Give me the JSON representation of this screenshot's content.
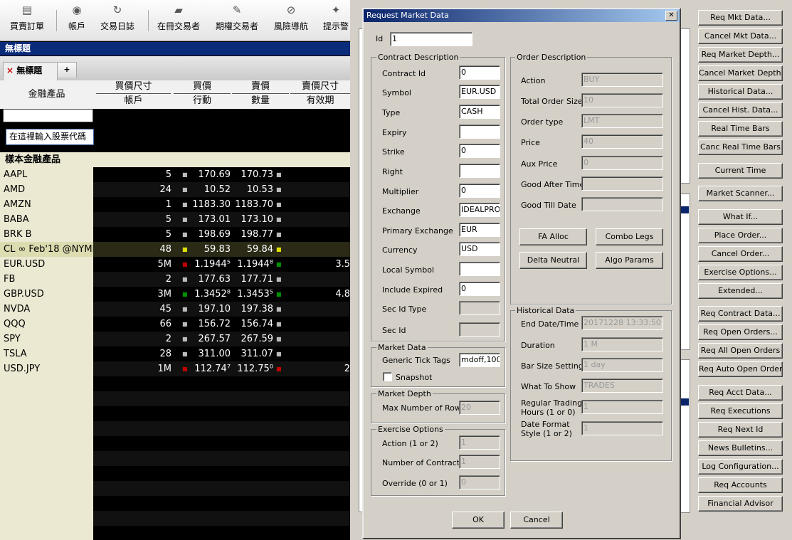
{
  "toolbar": {
    "buttons": [
      {
        "label": "買賣訂單",
        "icon": "order-icon"
      },
      {
        "label": "帳戶",
        "icon": "account-coins-icon"
      },
      {
        "label": "交易日誌",
        "icon": "trade-log-icon"
      },
      {
        "label": "在冊交易者",
        "icon": "book-trader-icon"
      },
      {
        "label": "期權交易者",
        "icon": "option-trader-icon"
      },
      {
        "label": "風險導航",
        "icon": "compass-icon"
      },
      {
        "label": "提示警",
        "icon": "alert-icon"
      }
    ]
  },
  "window": {
    "title": "無標題"
  },
  "tabs": [
    {
      "label": "無標題",
      "close": "×"
    },
    {
      "label": "+"
    }
  ],
  "columns": {
    "row1": [
      "買價尺寸",
      "買價",
      "賣價",
      "賣價尺寸"
    ],
    "row2": [
      "帳戶",
      "行動",
      "數量",
      "有效期"
    ],
    "instrument": "金融產品"
  },
  "symbol_input": {
    "value": "",
    "tooltip": "在這裡輸入股票代碼"
  },
  "section_header": "樣本金融產品",
  "quotes": [
    {
      "symbol": "AAPL",
      "bid_size": "5",
      "bid": "170.69",
      "ask": "170.73",
      "ask_size": "",
      "tick": "w"
    },
    {
      "symbol": "AMD",
      "bid_size": "24",
      "bid": "10.52",
      "ask": "10.53",
      "ask_size": "",
      "tick": "w"
    },
    {
      "symbol": "AMZN",
      "bid_size": "1",
      "bid": "1183.30",
      "ask": "1183.70",
      "ask_size": "",
      "tick": "w"
    },
    {
      "symbol": "BABA",
      "bid_size": "5",
      "bid": "173.01",
      "ask": "173.10",
      "ask_size": "",
      "tick": "w"
    },
    {
      "symbol": "BRK B",
      "bid_size": "5",
      "bid": "198.69",
      "ask": "198.77",
      "ask_size": "",
      "tick": "w"
    },
    {
      "symbol": "CL ∞ Feb'18 @NYMEX",
      "bid_size": "48",
      "bid": "59.83",
      "ask": "59.84",
      "ask_size": "",
      "tick": "y"
    },
    {
      "symbol": "EUR.USD",
      "bid_size": "5M",
      "bid": "1.1944⁵",
      "ask": "1.1944⁸",
      "ask_size": "3.5",
      "tick": "rg"
    },
    {
      "symbol": "FB",
      "bid_size": "2",
      "bid": "177.63",
      "ask": "177.71",
      "ask_size": "",
      "tick": "w"
    },
    {
      "symbol": "GBP.USD",
      "bid_size": "3M",
      "bid": "1.3452⁸",
      "ask": "1.3453⁵",
      "ask_size": "4.8",
      "tick": "gg"
    },
    {
      "symbol": "NVDA",
      "bid_size": "45",
      "bid": "197.10",
      "ask": "197.38",
      "ask_size": "",
      "tick": "w"
    },
    {
      "symbol": "QQQ",
      "bid_size": "66",
      "bid": "156.72",
      "ask": "156.74",
      "ask_size": "",
      "tick": "w"
    },
    {
      "symbol": "SPY",
      "bid_size": "2",
      "bid": "267.57",
      "ask": "267.59",
      "ask_size": "",
      "tick": "w"
    },
    {
      "symbol": "TSLA",
      "bid_size": "28",
      "bid": "311.00",
      "ask": "311.07",
      "ask_size": "",
      "tick": "w"
    },
    {
      "symbol": "USD.JPY",
      "bid_size": "1M",
      "bid": "112.74⁷",
      "ask": "112.75⁰",
      "ask_size": "2",
      "tick": "rr"
    }
  ],
  "right_buttons": [
    "Req Mkt Data...",
    "Cancel Mkt Data...",
    "Req Market Depth...",
    "Cancel Market Depth...",
    "Historical Data...",
    "Cancel Hist. Data...",
    "Real Time Bars",
    "Canc Real Time Bars",
    "Current Time",
    "Market Scanner...",
    "What If...",
    "Place Order...",
    "Cancel Order...",
    "Exercise Options...",
    "Extended...",
    "Req Contract Data...",
    "Req Open Orders...",
    "Req All Open Orders",
    "Req Auto Open Orders",
    "Req Acct Data...",
    "Req Executions",
    "Req Next Id",
    "News Bulletins...",
    "Log Configuration...",
    "Req Accounts",
    "Financial Advisor"
  ],
  "dialog": {
    "title": "Request Market Data",
    "close": "✕",
    "id_label": "Id",
    "id_value": "1",
    "contract": {
      "title": "Contract Description",
      "fields": [
        {
          "label": "Contract Id",
          "value": "0"
        },
        {
          "label": "Symbol",
          "value": "EUR.USD"
        },
        {
          "label": "Type",
          "value": "CASH"
        },
        {
          "label": "Expiry",
          "value": ""
        },
        {
          "label": "Strike",
          "value": "0"
        },
        {
          "label": "Right",
          "value": ""
        },
        {
          "label": "Multiplier",
          "value": "0"
        },
        {
          "label": "Exchange",
          "value": "IDEALPRO"
        },
        {
          "label": "Primary Exchange",
          "value": "EUR"
        },
        {
          "label": "Currency",
          "value": "USD"
        },
        {
          "label": "Local Symbol",
          "value": ""
        },
        {
          "label": "Include Expired",
          "value": "0"
        },
        {
          "label": "Sec Id Type",
          "value": ""
        },
        {
          "label": "Sec Id",
          "value": ""
        }
      ]
    },
    "market_data": {
      "title": "Market Data",
      "tick_label": "Generic Tick Tags",
      "tick_value": "mdoff,100,1",
      "snapshot_label": "Snapshot"
    },
    "market_depth": {
      "title": "Market Depth",
      "rows_label": "Max Number of Rows",
      "rows_value": "20"
    },
    "exercise": {
      "title": "Exercise Options",
      "fields": [
        {
          "label": "Action (1 or 2)",
          "value": "1"
        },
        {
          "label": "Number of Contracts",
          "value": "1"
        },
        {
          "label": "Override (0 or 1)",
          "value": "0"
        }
      ]
    },
    "order": {
      "title": "Order Description",
      "fields": [
        {
          "label": "Action",
          "value": "BUY"
        },
        {
          "label": "Total Order Size",
          "value": "10"
        },
        {
          "label": "Order type",
          "value": "LMT"
        },
        {
          "label": "Price",
          "value": "40"
        },
        {
          "label": "Aux Price",
          "value": "0"
        },
        {
          "label": "Good After Time",
          "value": ""
        },
        {
          "label": "Good Till Date",
          "value": ""
        }
      ],
      "buttons": [
        "FA Alloc",
        "Combo Legs",
        "Delta Neutral",
        "Algo Params"
      ]
    },
    "historical": {
      "title": "Historical Data",
      "fields": [
        {
          "label": "End Date/Time",
          "value": "20171228 13:33:50"
        },
        {
          "label": "Duration",
          "value": "1 M"
        },
        {
          "label": "Bar Size Setting",
          "value": "1 day"
        },
        {
          "label": "What To Show",
          "value": "TRADES"
        },
        {
          "label": "Regular Trading Hours (1 or 0)",
          "value": "1"
        },
        {
          "label": "Date Format Style (1 or 2)",
          "value": "1"
        }
      ]
    },
    "ok_label": "OK",
    "cancel_label": "Cancel"
  }
}
